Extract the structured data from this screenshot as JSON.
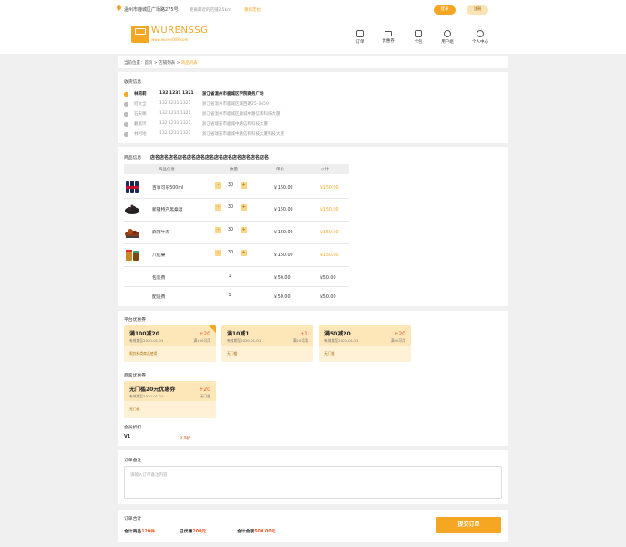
{
  "topbar": {
    "location": "温州市鹿城区广场路275号",
    "nearby": "距离最近的店铺2.5km",
    "relocate": "重新定位",
    "login": "登录",
    "register": "注册"
  },
  "header": {
    "logo_name": "WURENSSG",
    "logo_url": "www.wuren009.com",
    "nav": [
      {
        "label": "订单",
        "icon": "order-icon"
      },
      {
        "label": "优惠券",
        "icon": "coupon-icon"
      },
      {
        "label": "卡包",
        "icon": "card-icon"
      },
      {
        "label": "用户组",
        "icon": "user-group-icon"
      },
      {
        "label": "个人中心",
        "icon": "profile-icon"
      }
    ]
  },
  "breadcrumb": {
    "prefix": "当前位置：",
    "home": "首页",
    "sep1": " > ",
    "list": "店铺列表",
    "sep2": " > ",
    "current": "商品列表"
  },
  "receiver": {
    "title": "收货信息",
    "addresses": [
      {
        "name": "林莉莉",
        "phone": "132 1231 1321",
        "address": "浙江省温州市鹿城区学院商务广场",
        "selected": true
      },
      {
        "name": "何文全",
        "phone": "132 1231 1321",
        "address": "浙江省温州市鹿城区城西路25-3659",
        "selected": false
      },
      {
        "name": "石天赐",
        "phone": "132 1231 1321",
        "address": "浙江省温州市鹿城区鹿城中路信和科技大厦",
        "selected": false
      },
      {
        "name": "戴富玲",
        "phone": "132 1231 1321",
        "address": "浙江省瑞安市鹿城中路信和科技大厦",
        "selected": false
      },
      {
        "name": "林柯地",
        "phone": "132 1231 1321",
        "address": "浙江省瑞安市鹿城中路信和科技大厦科技大厦",
        "selected": false
      }
    ]
  },
  "goods": {
    "title": "商品信息",
    "shop_name": "店名店名店名店名店名店名店名店名店名店名店名店名店名",
    "columns": [
      "商品信息",
      "数量",
      "单价",
      "小计"
    ],
    "items": [
      {
        "name": "百事可乐500ml",
        "qty": "30",
        "price": "￥150.00",
        "subtotal": "￥150.00",
        "img": "cola-bottles"
      },
      {
        "name": "新疆特产黑桑葚",
        "qty": "30",
        "price": "￥150.00",
        "subtotal": "￥150.00",
        "img": "mulberries"
      },
      {
        "name": "麻辣牛肉",
        "qty": "30",
        "price": "￥150.00",
        "subtotal": "￥150.00",
        "img": "spicy-beef"
      },
      {
        "name": "八仙果",
        "qty": "30",
        "price": "￥150.00",
        "subtotal": "￥150.00",
        "img": "fruit-jar"
      }
    ],
    "fees": [
      {
        "name": "包装费",
        "qty": "1",
        "price": "￥50.00",
        "subtotal": "￥50.00"
      },
      {
        "name": "配送费",
        "qty": "1",
        "price": "￥50.00",
        "subtotal": "￥50.00"
      }
    ],
    "minus": "-",
    "plus": "+"
  },
  "platform_coupons": {
    "title": "平台优惠券",
    "items": [
      {
        "title": "满100减20",
        "expiry": "有效期至2020-01-01",
        "amount": "+20",
        "condition": "满100可用",
        "scope": "限饮料类商品使用",
        "selected": true
      },
      {
        "title": "满10减1",
        "expiry": "有效期至2020-01-01",
        "amount": "+1",
        "condition": "满10可用",
        "scope": "无门槛",
        "selected": false
      },
      {
        "title": "满50减20",
        "expiry": "有效期至2020-01-01",
        "amount": "+20",
        "condition": "满50可用",
        "scope": "无门槛",
        "selected": false
      }
    ]
  },
  "merchant_coupons": {
    "title": "商家优惠券",
    "items": [
      {
        "title": "无门槛20元优惠券",
        "expiry": "有效期至2020-01-01",
        "amount": "+20",
        "condition": "无门槛",
        "scope": "无门槛"
      }
    ]
  },
  "member": {
    "title": "会员折扣",
    "level": "V1",
    "discount": "9.9折"
  },
  "remark": {
    "title": "订单备注",
    "placeholder": "请输入订单备注内容"
  },
  "summary": {
    "title": "订单合计",
    "goods_label": "合计商品",
    "goods_count": "120件",
    "discount_label": "已优惠",
    "discount_value": "200元",
    "total_label": "合计金额",
    "total_value": "500.00元",
    "submit": "提交订单"
  },
  "colors": {
    "accent": "#f5a623",
    "highlight": "#f05a28"
  }
}
